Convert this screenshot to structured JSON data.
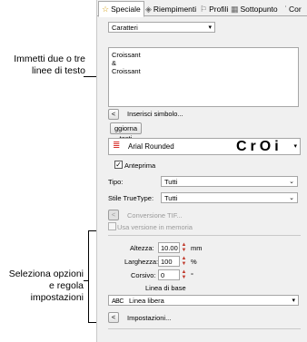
{
  "callouts": {
    "text_lines": "Immetti due o tre linee di testo",
    "options": "Seleziona opzioni e regola impostazioni"
  },
  "tabs": [
    {
      "label": "Speciale",
      "icon": "star-icon"
    },
    {
      "label": "Riempimenti",
      "icon": "fill-icon"
    },
    {
      "label": "Profili",
      "icon": "outline-icon"
    },
    {
      "label": "Sottopunto",
      "icon": "underlay-icon"
    },
    {
      "label": "Cor",
      "icon": "corner-icon"
    }
  ],
  "type_combo": "Caratteri",
  "text_lines": [
    "Croissant",
    "&",
    "Croissant"
  ],
  "insert_symbol_label": "Inserisci simbolo...",
  "update_text_button": "ggiorna testi",
  "font": {
    "name": "Arial Rounded",
    "preview": "CrOi"
  },
  "preview_checkbox": {
    "label": "Anteprima",
    "checked": true
  },
  "tipo": {
    "label": "Tipo:",
    "value": "Tutti"
  },
  "truetype": {
    "label": "Stile TrueType:",
    "value": "Tutti"
  },
  "convert_tif": "Conversione TIF...",
  "memory_version": {
    "label": "Usa versione in memoria",
    "checked": false
  },
  "height": {
    "label": "Altezza:",
    "value": "10.00",
    "unit": "mm"
  },
  "width": {
    "label": "Larghezza:",
    "value": "100",
    "unit": "%"
  },
  "italic": {
    "label": "Corsivo:",
    "value": "0",
    "unit": "°"
  },
  "baseline": {
    "label": "Linea di base",
    "icon_text": "ABC",
    "value": "Linea libera"
  },
  "settings_label": "Impostazioni..."
}
